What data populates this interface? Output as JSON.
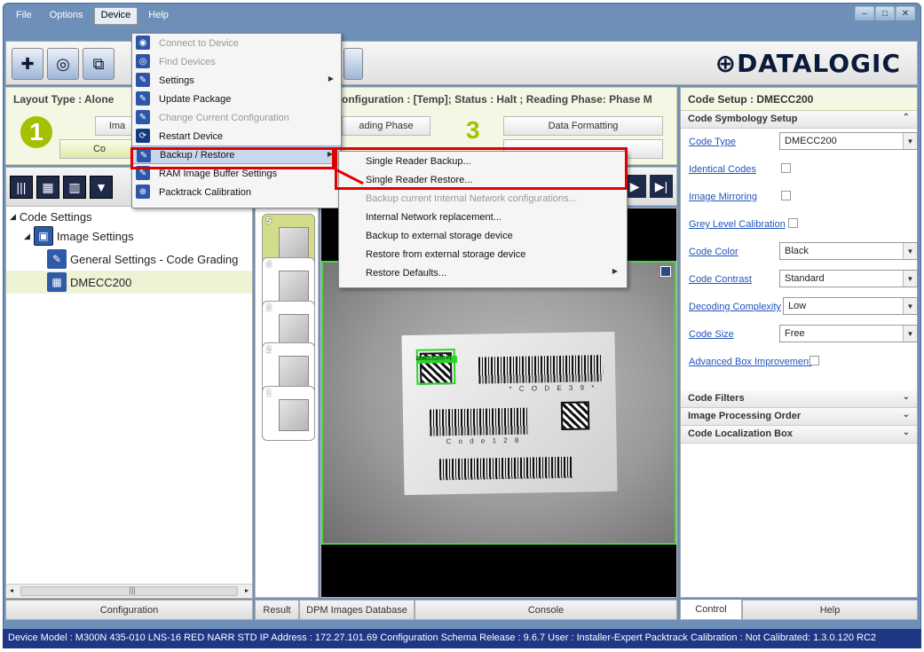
{
  "menubar": [
    "File",
    "Options",
    "Device",
    "Help"
  ],
  "window_controls": [
    "–",
    "□",
    "✕"
  ],
  "logo_text": "DATALOGIC",
  "layout": {
    "title": "Layout Type : Alone",
    "config_status": "onfiguration : [Temp];  Status : Halt ;  Reading Phase: Phase M",
    "btn_image": "Ima",
    "btn_co": "Co",
    "btn_reading_phase": "ading Phase",
    "btn_data_formatting": "Data Formatting",
    "step1": "1",
    "step3": "3"
  },
  "tree": {
    "code_settings": "Code Settings",
    "image_settings": "Image Settings",
    "general_settings": "General Settings - Code Grading",
    "dmecc200": "DMECC200"
  },
  "thumbnails": [
    "5",
    "4",
    "3",
    "2",
    "1"
  ],
  "image": {
    "code39_text": "* C O D E   3 9 *",
    "code128_text": "C o d e   1 2 8",
    "dm_label": "DMECC200 #1"
  },
  "bottom_tabs": {
    "configuration": "Configuration",
    "result": "Result",
    "dpm": "DPM Images Database",
    "console": "Console",
    "control": "Control",
    "help": "Help"
  },
  "right_panel": {
    "title": "Code Setup :  DMECC200",
    "symbology_section": "Code Symbology Setup",
    "code_type_label": "Code Type",
    "code_type_value": "DMECC200",
    "identical_codes": "Identical Codes",
    "image_mirroring": "Image Mirroring",
    "grey_level": "Grey Level Calibration",
    "code_color_label": "Code Color",
    "code_color_value": "Black",
    "code_contrast_label": "Code Contrast",
    "code_contrast_value": "Standard",
    "decoding_label": "Decoding Complexity",
    "decoding_value": "Low",
    "code_size_label": "Code Size",
    "code_size_value": "Free",
    "advanced_box": "Advanced Box Improvement",
    "code_filters": "Code Filters",
    "image_processing": "Image Processing Order",
    "code_localization": "Code Localization Box"
  },
  "device_menu": [
    {
      "label": "Connect to Device",
      "disabled": true,
      "icon": "connect-icon"
    },
    {
      "label": "Find Devices",
      "disabled": true,
      "icon": "find-icon"
    },
    {
      "label": "Settings",
      "submenu": true,
      "icon": "wrench-icon"
    },
    {
      "label": "Update Package",
      "icon": "wrench-icon"
    },
    {
      "label": "Change Current Configuration",
      "disabled": true,
      "icon": "wrench-icon"
    },
    {
      "label": "Restart Device",
      "icon": "restart-icon"
    },
    {
      "label": "Backup / Restore",
      "submenu": true,
      "highlight": true,
      "icon": "wrench-icon"
    },
    {
      "label": "RAM Image Buffer Settings",
      "icon": "wrench-icon"
    },
    {
      "label": "Packtrack Calibration",
      "icon": "target-icon"
    }
  ],
  "backup_submenu": [
    {
      "label": "Single Reader Backup..."
    },
    {
      "label": "Single Reader Restore..."
    },
    {
      "label": "Backup current Internal Network configurations...",
      "disabled": true
    },
    {
      "label": "Internal Network replacement..."
    },
    {
      "label": "Backup to external storage device"
    },
    {
      "label": "Restore from external storage device"
    },
    {
      "label": "Restore Defaults...",
      "submenu": true
    }
  ],
  "status_bar": "Device Model : M300N 435-010 LNS-16 RED NARR STD   IP Address :  172.27.101.69   Configuration Schema Release :  9.6.7   User : Installer-Expert   Packtrack Calibration : Not Calibrated: 1.3.0.120 RC2",
  "colors": {
    "accent_green": "#a4c000",
    "status_bar": "#1f3784",
    "highlight_red": "#e00000"
  }
}
